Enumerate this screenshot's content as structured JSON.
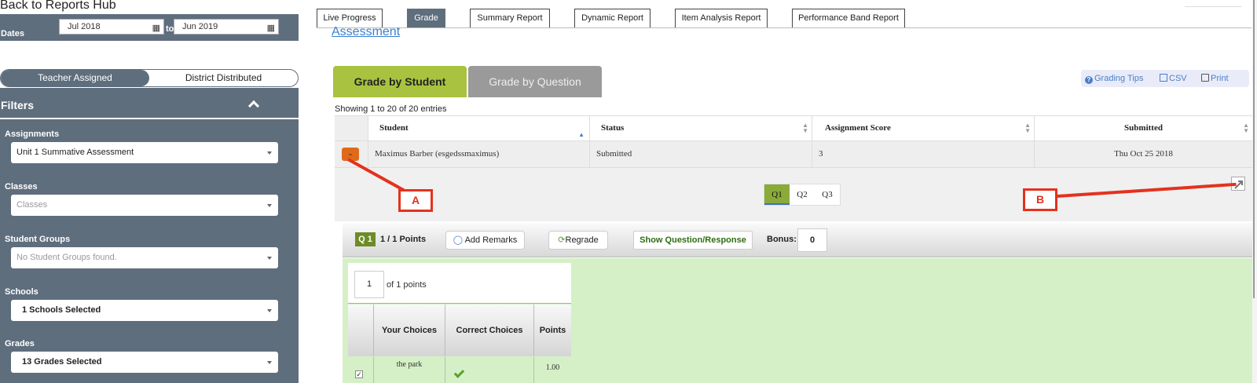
{
  "sidebar": {
    "back_link": "Back to Reports Hub",
    "dates_label": "Dates",
    "date_from": "Jul 2018",
    "date_to_sep": "to",
    "date_to": "Jun 2019",
    "toggle_active": "Teacher Assigned",
    "toggle_inactive": "District Distributed",
    "filters_title": "Filters",
    "filters": {
      "assignments_label": "Assignments",
      "assignments_value": "Unit 1 Summative Assessment",
      "classes_label": "Classes",
      "classes_placeholder": "Classes",
      "student_groups_label": "Student Groups",
      "student_groups_placeholder": "No Student Groups found.",
      "schools_label": "Schools",
      "schools_value": "1 Schools Selected",
      "grades_label": "Grades",
      "grades_value": "13 Grades Selected"
    }
  },
  "report_tabs": [
    {
      "label": "Live Progress",
      "active": false
    },
    {
      "label": "Grade",
      "active": true
    },
    {
      "label": "Summary Report",
      "active": false
    },
    {
      "label": "Dynamic Report",
      "active": false
    },
    {
      "label": "Item Analysis Report",
      "active": false
    },
    {
      "label": "Performance Band Report",
      "active": false
    }
  ],
  "assessment_link": "Assessment",
  "grade_tabs": {
    "by_student": "Grade by Student",
    "by_question": "Grade by Question"
  },
  "tools": {
    "grading_tips": "Grading Tips",
    "csv": "CSV",
    "print": "Print"
  },
  "entries_info": "Showing 1 to 20 of 20 entries",
  "table": {
    "columns": [
      "Student",
      "Status",
      "Assignment Score",
      "Submitted"
    ],
    "row": {
      "expand": "-",
      "student": "Maximus Barber (esgedssmaximus)",
      "status": "Submitted",
      "score": "3",
      "submitted": "Thu Oct 25 2018"
    }
  },
  "question_tabs": [
    "Q1",
    "Q2",
    "Q3"
  ],
  "question_bar": {
    "badge": "Q 1",
    "points": "1 / 1 Points",
    "add_remarks": "Add Remarks",
    "regrade": "Regrade",
    "show_question": "Show Question/Response",
    "bonus_label": "Bonus:",
    "bonus_value": "0"
  },
  "scoring": {
    "points_value": "1",
    "points_of": "of 1 points",
    "choices_headers": [
      "Your Choices",
      "Correct Choices",
      "Points"
    ],
    "choice_row": {
      "checkbox": "✓",
      "your_choice": "the park",
      "points": "1.00"
    }
  },
  "annotations": {
    "a": "A",
    "b": "B"
  },
  "colors": {
    "sidebar": "#5f6e7d",
    "accent_green": "#a9c23f",
    "annotation_red": "#e3321e",
    "panel_green": "#d5f0c6",
    "expand_orange": "#e06a1a"
  }
}
